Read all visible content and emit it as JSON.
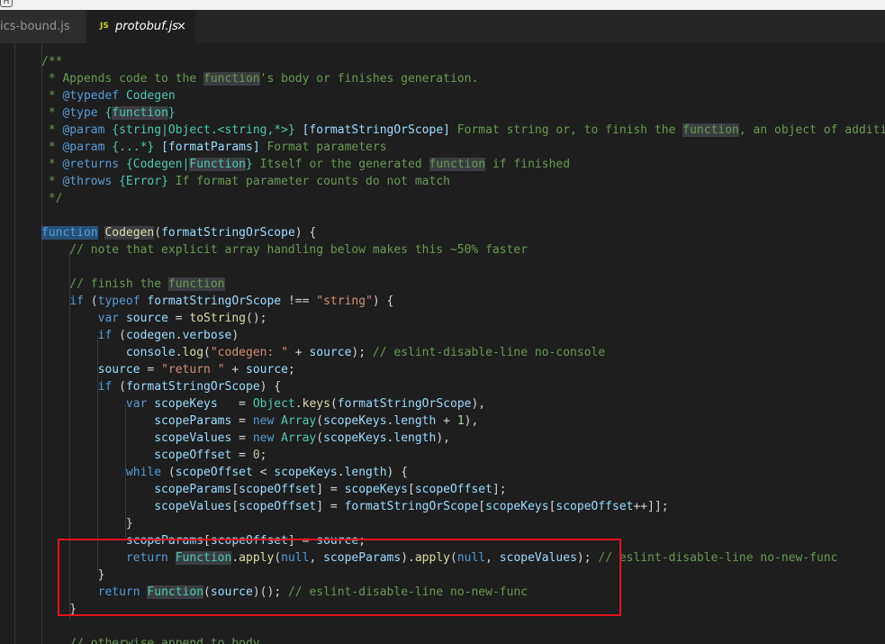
{
  "tabs": [
    {
      "label": "ics-bound.js",
      "active": false
    },
    {
      "label": "protobuf.js",
      "active": true,
      "icon_text": "JS",
      "close": "×"
    }
  ],
  "top_glyph": "H",
  "colors": {
    "editor_bg": "#1e1e1e",
    "comment": "#6a9955",
    "keyword": "#569cd6",
    "string": "#ce9178",
    "type": "#4ec9b0",
    "function": "#dcdcaa",
    "variable": "#9cdcfe",
    "number": "#b5cea8",
    "annotation_box": "#e81123"
  },
  "code_lines": [
    "/**",
    " * Appends code to the function's body or finishes generation.",
    " * @typedef Codegen",
    " * @type {function}",
    " * @param {string|Object.<string,*>} [formatStringOrScope] Format string or, to finish the function, an object of addition",
    " * @param {...*} [formatParams] Format parameters",
    " * @returns {Codegen|Function} Itself or the generated function if finished",
    " * @throws {Error} If format parameter counts do not match",
    " */",
    "",
    "function Codegen(formatStringOrScope) {",
    "    // note that explicit array handling below makes this ~50% faster",
    "",
    "    // finish the function",
    "    if (typeof formatStringOrScope !== \"string\") {",
    "        var source = toString();",
    "        if (codegen.verbose)",
    "            console.log(\"codegen: \" + source); // eslint-disable-line no-console",
    "        source = \"return \" + source;",
    "        if (formatStringOrScope) {",
    "            var scopeKeys   = Object.keys(formatStringOrScope),",
    "                scopeParams = new Array(scopeKeys.length + 1),",
    "                scopeValues = new Array(scopeKeys.length),",
    "                scopeOffset = 0;",
    "            while (scopeOffset < scopeKeys.length) {",
    "                scopeParams[scopeOffset] = scopeKeys[scopeOffset];",
    "                scopeValues[scopeOffset] = formatStringOrScope[scopeKeys[scopeOffset++]];",
    "            }",
    "            scopeParams[scopeOffset] = source;",
    "            return Function.apply(null, scopeParams).apply(null, scopeValues); // eslint-disable-line no-new-func",
    "        }",
    "        return Function(source)(); // eslint-disable-line no-new-func",
    "    }",
    "",
    "    // otherwise append to body"
  ]
}
